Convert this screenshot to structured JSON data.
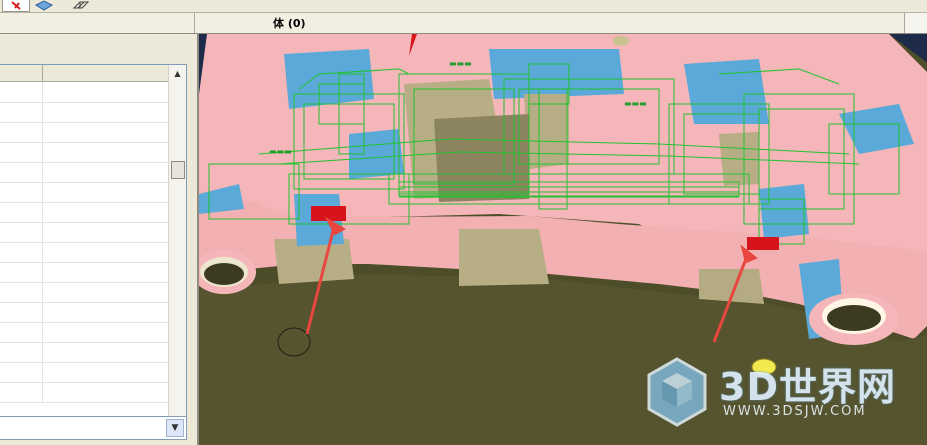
{
  "window": {
    "title": "体 (0)"
  },
  "toolbar": {
    "icons": [
      "red-marker-icon",
      "blue-cube-icon",
      "wire-box-icon"
    ]
  },
  "table": {
    "row_count": 16
  },
  "viewport": {
    "colors": {
      "core_pink": "#f4b6b9",
      "cut_blue": "#5aa9d8",
      "base_olive": "#4e4d2a",
      "wire_green": "#22c330",
      "marker_red": "#d7141b",
      "arrow_red": "#e8463e"
    }
  },
  "watermark": {
    "title": "3D世界网",
    "url": "WWW.3DSJW.COM"
  }
}
